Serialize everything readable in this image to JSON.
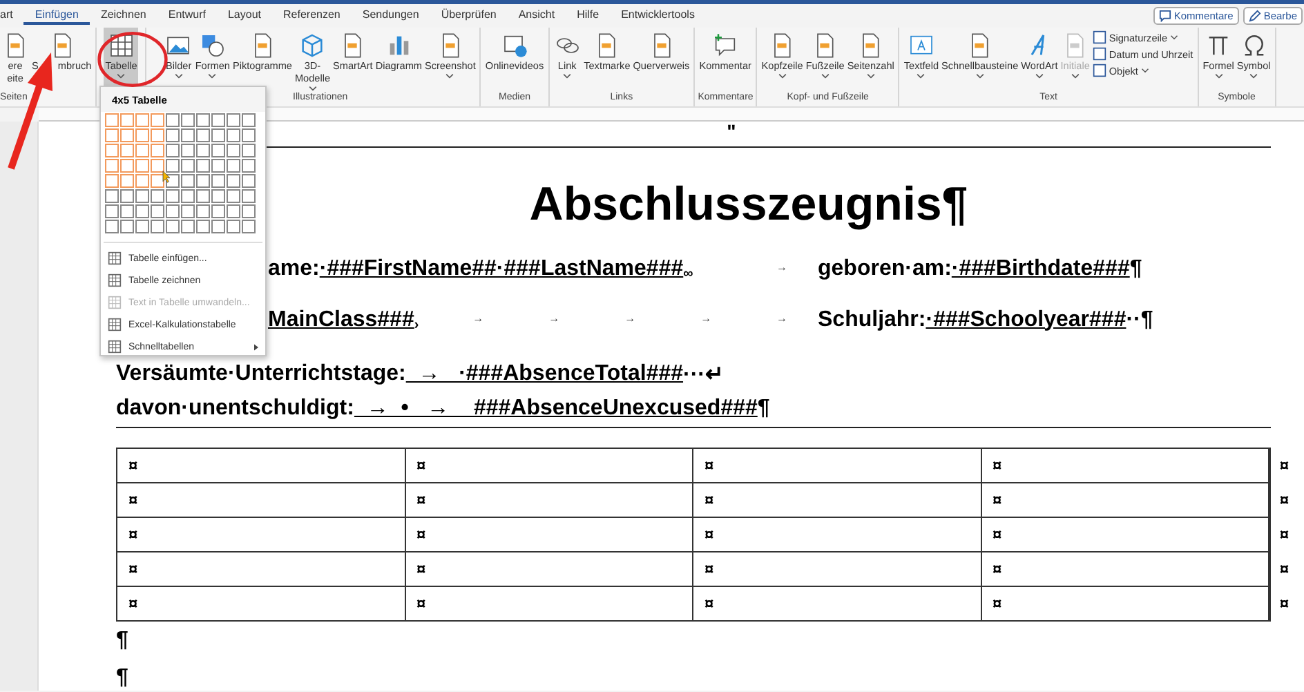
{
  "tabs": [
    {
      "label": "art",
      "selected": false
    },
    {
      "label": "Einfügen",
      "selected": true
    },
    {
      "label": "Zeichnen",
      "selected": false
    },
    {
      "label": "Entwurf",
      "selected": false
    },
    {
      "label": "Layout",
      "selected": false
    },
    {
      "label": "Referenzen",
      "selected": false
    },
    {
      "label": "Sendungen",
      "selected": false
    },
    {
      "label": "Überprüfen",
      "selected": false
    },
    {
      "label": "Ansicht",
      "selected": false
    },
    {
      "label": "Hilfe",
      "selected": false
    },
    {
      "label": "Entwicklertools",
      "selected": false
    }
  ],
  "header_buttons": [
    "Kommentare",
    "Bearbe"
  ],
  "ribbon_groups": [
    {
      "label": "Seiten",
      "buttons": [
        {
          "kind": "large",
          "label_parts": [
            "ere",
            "eite"
          ],
          "dropdown": false,
          "selected": false,
          "disabled": false
        },
        {
          "kind": "large",
          "label_parts": [
            "S",
            "mbruch"
          ],
          "dropdown": false,
          "selected": false,
          "disabled": false
        }
      ]
    },
    {
      "buttons": [
        {
          "kind": "large",
          "label_parts": [
            "Tabelle"
          ],
          "dropdown": true,
          "selected": true,
          "disabled": false
        }
      ]
    },
    {
      "label": "Illustrationen",
      "buttons": [
        {
          "kind": "large",
          "label_parts": [
            "Bilder"
          ],
          "dropdown": true,
          "selected": false,
          "disabled": false
        },
        {
          "kind": "large",
          "label_parts": [
            "Formen"
          ],
          "dropdown": true,
          "selected": false,
          "disabled": false
        },
        {
          "kind": "large",
          "label_parts": [
            "Piktogramme"
          ],
          "dropdown": false,
          "selected": false,
          "disabled": false
        },
        {
          "kind": "large",
          "label_parts": [
            "3D-",
            "Modelle"
          ],
          "dropdown": true,
          "selected": false,
          "disabled": false
        },
        {
          "kind": "large",
          "label_parts": [
            "SmartArt"
          ],
          "dropdown": false,
          "selected": false,
          "disabled": false
        },
        {
          "kind": "large",
          "label_parts": [
            "Diagramm"
          ],
          "dropdown": false,
          "selected": false,
          "disabled": false
        },
        {
          "kind": "large",
          "label_parts": [
            "Screenshot"
          ],
          "dropdown": true,
          "selected": false,
          "disabled": false
        }
      ]
    },
    {
      "label": "Medien",
      "buttons": [
        {
          "kind": "large",
          "label_parts": [
            "Onlinevideos"
          ],
          "dropdown": false,
          "selected": false,
          "disabled": false
        }
      ]
    },
    {
      "label": "Links",
      "buttons": [
        {
          "kind": "large",
          "label_parts": [
            "Link"
          ],
          "dropdown": true,
          "selected": false,
          "disabled": false
        },
        {
          "kind": "large",
          "label_parts": [
            "Textmarke"
          ],
          "dropdown": false,
          "selected": false,
          "disabled": false
        },
        {
          "kind": "large",
          "label_parts": [
            "Querverweis"
          ],
          "dropdown": false,
          "selected": false,
          "disabled": false
        }
      ]
    },
    {
      "label": "Kommentare",
      "buttons": [
        {
          "kind": "large",
          "label_parts": [
            "Kommentar"
          ],
          "dropdown": false,
          "selected": false,
          "disabled": false
        }
      ]
    },
    {
      "label": "Kopf- und Fußzeile",
      "buttons": [
        {
          "kind": "large",
          "label_parts": [
            "Kopfzeile"
          ],
          "dropdown": true,
          "selected": false,
          "disabled": false
        },
        {
          "kind": "large",
          "label_parts": [
            "Fußzeile"
          ],
          "dropdown": true,
          "selected": false,
          "disabled": false
        },
        {
          "kind": "large",
          "label_parts": [
            "Seitenzahl"
          ],
          "dropdown": true,
          "selected": false,
          "disabled": false
        }
      ]
    },
    {
      "label": "Text",
      "buttons": [
        {
          "kind": "large",
          "label_parts": [
            "Textfeld"
          ],
          "dropdown": true,
          "selected": false,
          "disabled": false
        },
        {
          "kind": "large",
          "label_parts": [
            "Schnellbausteine"
          ],
          "dropdown": true,
          "selected": false,
          "disabled": false
        },
        {
          "kind": "large",
          "label_parts": [
            "WordArt"
          ],
          "dropdown": true,
          "selected": false,
          "disabled": false
        },
        {
          "kind": "large",
          "label_parts": [
            "Initiale"
          ],
          "dropdown": true,
          "selected": false,
          "disabled": true
        },
        {
          "kind": "small",
          "label_parts": [
            "Signaturzeile"
          ],
          "dropdown": true,
          "selected": false,
          "disabled": false
        },
        {
          "kind": "small",
          "label_parts": [
            "Datum und Uhrzeit"
          ],
          "dropdown": false,
          "selected": false,
          "disabled": false
        },
        {
          "kind": "small",
          "label_parts": [
            "Objekt"
          ],
          "dropdown": true,
          "selected": false,
          "disabled": false
        }
      ]
    },
    {
      "label": "Symbole",
      "buttons": [
        {
          "kind": "large",
          "label_parts": [
            "Formel"
          ],
          "dropdown": true,
          "selected": false,
          "disabled": false
        },
        {
          "kind": "large",
          "label_parts": [
            "Symbol"
          ],
          "dropdown": true,
          "selected": false,
          "disabled": false
        }
      ]
    }
  ],
  "table_menu": {
    "title": "4x5 Tabelle",
    "grid": [
      {
        "cells": [
          {
            "selected": true
          },
          {
            "selected": true
          },
          {
            "selected": true
          },
          {
            "selected": true
          },
          {
            "selected": false
          },
          {
            "selected": false
          },
          {
            "selected": false
          },
          {
            "selected": false
          },
          {
            "selected": false
          },
          {
            "selected": false
          }
        ]
      },
      {
        "cells": [
          {
            "selected": true
          },
          {
            "selected": true
          },
          {
            "selected": true
          },
          {
            "selected": true
          },
          {
            "selected": false
          },
          {
            "selected": false
          },
          {
            "selected": false
          },
          {
            "selected": false
          },
          {
            "selected": false
          },
          {
            "selected": false
          }
        ]
      },
      {
        "cells": [
          {
            "selected": true
          },
          {
            "selected": true
          },
          {
            "selected": true
          },
          {
            "selected": true
          },
          {
            "selected": false
          },
          {
            "selected": false
          },
          {
            "selected": false
          },
          {
            "selected": false
          },
          {
            "selected": false
          },
          {
            "selected": false
          }
        ]
      },
      {
        "cells": [
          {
            "selected": true
          },
          {
            "selected": true
          },
          {
            "selected": true
          },
          {
            "selected": true
          },
          {
            "selected": false
          },
          {
            "selected": false
          },
          {
            "selected": false
          },
          {
            "selected": false
          },
          {
            "selected": false
          },
          {
            "selected": false
          }
        ]
      },
      {
        "cells": [
          {
            "selected": true
          },
          {
            "selected": true
          },
          {
            "selected": true
          },
          {
            "selected": true
          },
          {
            "selected": false
          },
          {
            "selected": false
          },
          {
            "selected": false
          },
          {
            "selected": false
          },
          {
            "selected": false
          },
          {
            "selected": false
          }
        ]
      },
      {
        "cells": [
          {
            "selected": false
          },
          {
            "selected": false
          },
          {
            "selected": false
          },
          {
            "selected": false
          },
          {
            "selected": false
          },
          {
            "selected": false
          },
          {
            "selected": false
          },
          {
            "selected": false
          },
          {
            "selected": false
          },
          {
            "selected": false
          }
        ]
      },
      {
        "cells": [
          {
            "selected": false
          },
          {
            "selected": false
          },
          {
            "selected": false
          },
          {
            "selected": false
          },
          {
            "selected": false
          },
          {
            "selected": false
          },
          {
            "selected": false
          },
          {
            "selected": false
          },
          {
            "selected": false
          },
          {
            "selected": false
          }
        ]
      },
      {
        "cells": [
          {
            "selected": false
          },
          {
            "selected": false
          },
          {
            "selected": false
          },
          {
            "selected": false
          },
          {
            "selected": false
          },
          {
            "selected": false
          },
          {
            "selected": false
          },
          {
            "selected": false
          },
          {
            "selected": false
          },
          {
            "selected": false
          }
        ]
      }
    ],
    "items": [
      {
        "label": "Tabelle einfügen...",
        "disabled": false,
        "submenu": false
      },
      {
        "label": "Tabelle zeichnen",
        "disabled": false,
        "submenu": false
      },
      {
        "label": "Text in Tabelle umwandeln...",
        "disabled": true,
        "submenu": false
      },
      {
        "label": "Excel-Kalkulationstabelle",
        "disabled": false,
        "submenu": false
      },
      {
        "label": "Schnelltabellen",
        "disabled": false,
        "submenu": true
      }
    ]
  },
  "document": {
    "top_mark": "\"",
    "title": "Abschlusszeugnis¶",
    "lines": [
      {
        "covered": true,
        "left": [
          {
            "kind": "text",
            "text": "ame:"
          },
          {
            "kind": "value",
            "text": "·###FirstName##·###LastName###"
          },
          {
            "kind": "mark",
            "text": "∞"
          },
          {
            "kind": "tab",
            "text": "→"
          }
        ],
        "right": [
          {
            "kind": "text",
            "text": "geboren·am:"
          },
          {
            "kind": "value",
            "text": "·###Birthdate###"
          },
          {
            "kind": "text",
            "text": "¶"
          }
        ]
      },
      {
        "covered": true,
        "left": [
          {
            "kind": "value",
            "text": "MainClass###"
          },
          {
            "kind": "mark",
            "text": "›"
          },
          {
            "kind": "tab",
            "text": "→"
          },
          {
            "kind": "tab",
            "text": "→"
          },
          {
            "kind": "tab",
            "text": "→"
          },
          {
            "kind": "tab",
            "text": "→"
          },
          {
            "kind": "tab",
            "text": "→"
          }
        ],
        "right": [
          {
            "kind": "text",
            "text": "Schuljahr:"
          },
          {
            "kind": "value",
            "text": "·###Schoolyear###"
          },
          {
            "kind": "text",
            "text": "··¶"
          }
        ]
      },
      {
        "covered": false,
        "left": [
          {
            "kind": "text",
            "text": "Versäumte·Unterrichtstage:"
          },
          {
            "kind": "value",
            "text": "  →   ·###AbsenceTotal###"
          },
          {
            "kind": "text",
            "text": "···↵"
          }
        ]
      },
      {
        "covered": false,
        "left": [
          {
            "kind": "text",
            "text": "davon·unentschuldigt:"
          },
          {
            "kind": "value",
            "text": "  →  •   →    ###AbsenceUnexcused###"
          },
          {
            "kind": "text",
            "text": "¶"
          }
        ]
      }
    ],
    "table": {
      "rows": [
        {
          "cells": [
            "¤",
            "¤",
            "¤",
            "¤"
          ],
          "end": "¤"
        },
        {
          "cells": [
            "¤",
            "¤",
            "¤",
            "¤"
          ],
          "end": "¤"
        },
        {
          "cells": [
            "¤",
            "¤",
            "¤",
            "¤"
          ],
          "end": "¤"
        },
        {
          "cells": [
            "¤",
            "¤",
            "¤",
            "¤"
          ],
          "end": "¤"
        },
        {
          "cells": [
            "¤",
            "¤",
            "¤",
            "¤"
          ],
          "end": "¤"
        }
      ]
    },
    "after": [
      "¶",
      "¶"
    ]
  }
}
